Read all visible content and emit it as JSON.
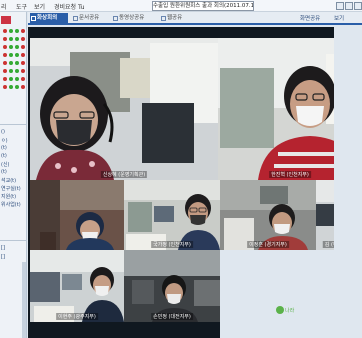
{
  "menu": {
    "items": [
      "리",
      "도구",
      "보기",
      "경비요청 Tu"
    ],
    "title": "수출입 원환위원회스 출과 회의(2011.07.12)"
  },
  "sidebar": {
    "labels": [
      "()",
      "ㅇ)",
      "(t)",
      "(t)",
      "(신)",
      "(t)",
      "석교(t)",
      "연구실(t)",
      "지원(t)",
      "위사업(t)"
    ],
    "bottom_labels": [
      "[]",
      "[]"
    ]
  },
  "tabs": [
    {
      "label": "화상회의",
      "active": true
    },
    {
      "label": "문서공유",
      "active": false
    },
    {
      "label": "동영상공유",
      "active": false
    },
    {
      "label": "웹공유",
      "active": false
    }
  ],
  "toolbar": {
    "screen_share": "화면공유",
    "view": "보기"
  },
  "participants": [
    {
      "name": "신상혜 (운영기획관)"
    },
    {
      "name": "한진혁 (인천지부)"
    },
    {
      "name": ""
    },
    {
      "name": "국가정 (인천지부)"
    },
    {
      "name": "이정훈 (경기지부)"
    },
    {
      "name": "김 (부산지부)"
    },
    {
      "name": "이현주 (광주지부)"
    },
    {
      "name": "손민정 (대전지부)"
    }
  ],
  "logo_text": "나라",
  "colors": {
    "accent": "#2a5ea8",
    "brand_green": "#5bb24a"
  }
}
